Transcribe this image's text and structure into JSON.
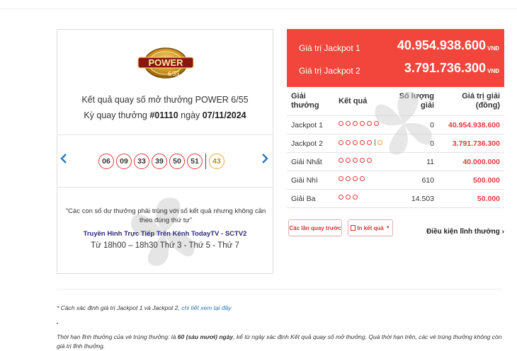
{
  "draw": {
    "logo_text": "POWER",
    "logo_sub": "6/55",
    "title": "Kết quả quay số mở thưởng POWER 6/55",
    "info_prefix": "Kỳ quay thưởng ",
    "draw_number": "#01110",
    "info_mid": " ngày ",
    "draw_date": "07/11/2024",
    "balls": [
      "06",
      "09",
      "33",
      "39",
      "50",
      "51"
    ],
    "power_ball": "43",
    "note": "\"Các con số dự thưởng phải trùng với số kết quả nhưng không cần theo đúng thứ tự\"",
    "channel": "Truyền Hình Trực Tiếp Trên Kênh TodayTV - SCTV2",
    "schedule": "Từ 18h00 – 18h30 Thứ 3 - Thứ 5 - Thứ 7"
  },
  "jackpots": [
    {
      "label": "Giá trị Jackpot 1",
      "value": "40.954.938.600",
      "unit": "VNĐ"
    },
    {
      "label": "Giá trị Jackpot 2",
      "value": "3.791.736.300",
      "unit": "VNĐ"
    }
  ],
  "table": {
    "headers": {
      "name_1": "Giải",
      "name_2": "thưởng",
      "result": "Kết quả",
      "count_1": "Số lượng",
      "count_2": "giải",
      "value_1": "Giá trị giải",
      "value_2": "(đồng)"
    },
    "rows": [
      {
        "name": "Jackpot 1",
        "count": "0",
        "value": "40.954.938.600"
      },
      {
        "name": "Jackpot 2",
        "count": "0",
        "value": "3.791.736.300"
      },
      {
        "name": "Giải Nhất",
        "count": "11",
        "value": "40.000.000"
      },
      {
        "name": "Giải Nhì",
        "count": "610",
        "value": "500.000"
      },
      {
        "name": "Giải Ba",
        "count": "14.503",
        "value": "50.000"
      }
    ]
  },
  "buttons": {
    "history": "Các lần quay trước",
    "print": "In kết quả",
    "conditions": "Điều kiện lĩnh thưởng"
  },
  "footer": {
    "footnote_prefix": "* Cách xác định giá trị Jackpot 1 và Jackpot 2, ",
    "footnote_link": "chi tiết xem tại đây",
    "redeem_prefix": "Thời hạn lĩnh thưởng của vé trúng thưởng: là ",
    "redeem_bold": "60 (sáu mươi) ngày",
    "redeem_suffix": ", kể từ ngày xác định Kết quả quay số mở thưởng. Quá thời hạn trên, các vé trúng thưởng không còn giá trị lĩnh thưởng."
  },
  "colors": {
    "accent_red": "#f2453b",
    "ball_red": "#e23b3b",
    "power_gold": "#e8a93a",
    "link_blue": "#2a78b8"
  }
}
